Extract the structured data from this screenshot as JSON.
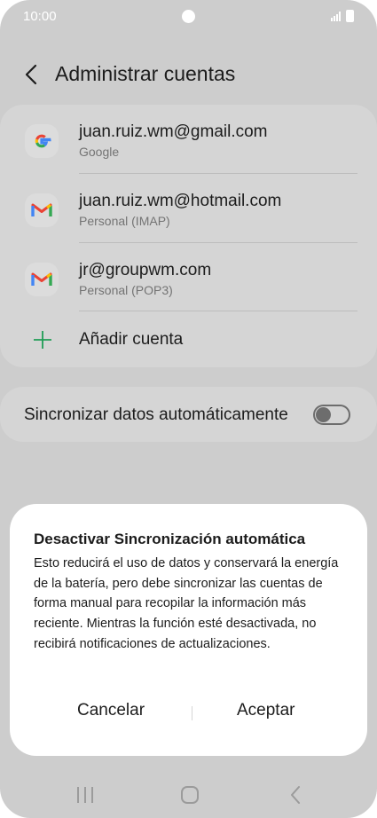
{
  "status_bar": {
    "time": "10:00"
  },
  "header": {
    "title": "Administrar cuentas"
  },
  "accounts": [
    {
      "email": "juan.ruiz.wm@gmail.com",
      "type": "Google",
      "icon": "google-icon"
    },
    {
      "email": "juan.ruiz.wm@hotmail.com",
      "type": "Personal (IMAP)",
      "icon": "gmail-icon"
    },
    {
      "email": "jr@groupwm.com",
      "type": "Personal (POP3)",
      "icon": "gmail-icon"
    }
  ],
  "add_account": {
    "label": "Añadir cuenta",
    "icon": "plus-icon"
  },
  "sync": {
    "label": "Sincronizar datos automáticamente",
    "enabled": false
  },
  "dialog": {
    "title": "Desactivar Sincronización automática",
    "body": "Esto reducirá el uso de datos y conservará la energía de la batería, pero debe sincronizar las cuentas de forma manual para recopilar la información más reciente. Mientras la función esté desactivada, no recibirá notificaciones de actualizaciones.",
    "cancel_label": "Cancelar",
    "accept_label": "Aceptar"
  },
  "colors": {
    "scrim_background": "#cdcdcd",
    "card_background": "#d5d5d5",
    "dialog_background": "#ffffff",
    "accent_green": "#1f9d55",
    "text_primary": "#1c1c1c",
    "text_secondary": "#747474"
  }
}
